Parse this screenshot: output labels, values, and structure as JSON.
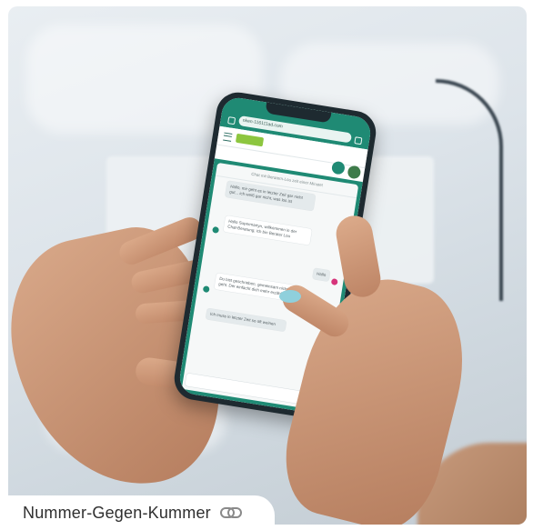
{
  "caption": {
    "title": "Nummer-Gegen-Kummer",
    "icon": "link-icon"
  },
  "photo": {
    "subject": "",
    "phone_screen": {
      "url": "nken-116111ad.com",
      "chat_header": "Chat mit Beratern-Lou zeit einer Minute!",
      "messages": [
        {
          "from": "bot",
          "text": "Hallo, mir geht es in letzter Zeit gar nicht gut... ich weiß gar nicht, was los ist"
        },
        {
          "from": "bot",
          "text": "Hallo Supermartyn, willkommen in der Chat-Beratung; ich bin Berater Lou"
        },
        {
          "from": "user",
          "text": "Hallo"
        },
        {
          "from": "bot",
          "text": "Du bist geschrieben, gemeinsam nicht gut geht. Der einfacht dich mehr erzählen?"
        },
        {
          "from": "bot",
          "text": "Ich muss in letzter Zeit so oft weinen"
        }
      ]
    }
  },
  "colors": {
    "accent_green": "#1f8a74",
    "accent_pink": "#d6337a",
    "lime_logo": "#8dc63f",
    "nail_blue": "#8fd0dc"
  }
}
